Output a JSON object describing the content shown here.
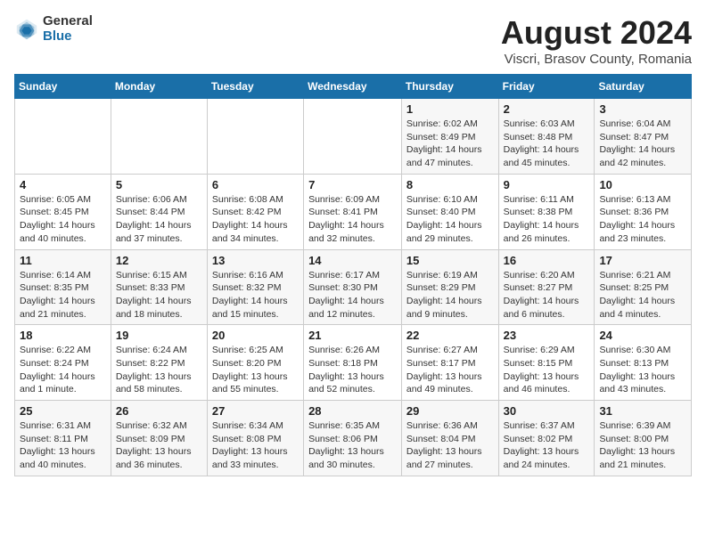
{
  "logo": {
    "general": "General",
    "blue": "Blue"
  },
  "title": "August 2024",
  "subtitle": "Viscri, Brasov County, Romania",
  "days_of_week": [
    "Sunday",
    "Monday",
    "Tuesday",
    "Wednesday",
    "Thursday",
    "Friday",
    "Saturday"
  ],
  "weeks": [
    [
      {
        "day": "",
        "info": ""
      },
      {
        "day": "",
        "info": ""
      },
      {
        "day": "",
        "info": ""
      },
      {
        "day": "",
        "info": ""
      },
      {
        "day": "1",
        "info": "Sunrise: 6:02 AM\nSunset: 8:49 PM\nDaylight: 14 hours and 47 minutes."
      },
      {
        "day": "2",
        "info": "Sunrise: 6:03 AM\nSunset: 8:48 PM\nDaylight: 14 hours and 45 minutes."
      },
      {
        "day": "3",
        "info": "Sunrise: 6:04 AM\nSunset: 8:47 PM\nDaylight: 14 hours and 42 minutes."
      }
    ],
    [
      {
        "day": "4",
        "info": "Sunrise: 6:05 AM\nSunset: 8:45 PM\nDaylight: 14 hours and 40 minutes."
      },
      {
        "day": "5",
        "info": "Sunrise: 6:06 AM\nSunset: 8:44 PM\nDaylight: 14 hours and 37 minutes."
      },
      {
        "day": "6",
        "info": "Sunrise: 6:08 AM\nSunset: 8:42 PM\nDaylight: 14 hours and 34 minutes."
      },
      {
        "day": "7",
        "info": "Sunrise: 6:09 AM\nSunset: 8:41 PM\nDaylight: 14 hours and 32 minutes."
      },
      {
        "day": "8",
        "info": "Sunrise: 6:10 AM\nSunset: 8:40 PM\nDaylight: 14 hours and 29 minutes."
      },
      {
        "day": "9",
        "info": "Sunrise: 6:11 AM\nSunset: 8:38 PM\nDaylight: 14 hours and 26 minutes."
      },
      {
        "day": "10",
        "info": "Sunrise: 6:13 AM\nSunset: 8:36 PM\nDaylight: 14 hours and 23 minutes."
      }
    ],
    [
      {
        "day": "11",
        "info": "Sunrise: 6:14 AM\nSunset: 8:35 PM\nDaylight: 14 hours and 21 minutes."
      },
      {
        "day": "12",
        "info": "Sunrise: 6:15 AM\nSunset: 8:33 PM\nDaylight: 14 hours and 18 minutes."
      },
      {
        "day": "13",
        "info": "Sunrise: 6:16 AM\nSunset: 8:32 PM\nDaylight: 14 hours and 15 minutes."
      },
      {
        "day": "14",
        "info": "Sunrise: 6:17 AM\nSunset: 8:30 PM\nDaylight: 14 hours and 12 minutes."
      },
      {
        "day": "15",
        "info": "Sunrise: 6:19 AM\nSunset: 8:29 PM\nDaylight: 14 hours and 9 minutes."
      },
      {
        "day": "16",
        "info": "Sunrise: 6:20 AM\nSunset: 8:27 PM\nDaylight: 14 hours and 6 minutes."
      },
      {
        "day": "17",
        "info": "Sunrise: 6:21 AM\nSunset: 8:25 PM\nDaylight: 14 hours and 4 minutes."
      }
    ],
    [
      {
        "day": "18",
        "info": "Sunrise: 6:22 AM\nSunset: 8:24 PM\nDaylight: 14 hours and 1 minute."
      },
      {
        "day": "19",
        "info": "Sunrise: 6:24 AM\nSunset: 8:22 PM\nDaylight: 13 hours and 58 minutes."
      },
      {
        "day": "20",
        "info": "Sunrise: 6:25 AM\nSunset: 8:20 PM\nDaylight: 13 hours and 55 minutes."
      },
      {
        "day": "21",
        "info": "Sunrise: 6:26 AM\nSunset: 8:18 PM\nDaylight: 13 hours and 52 minutes."
      },
      {
        "day": "22",
        "info": "Sunrise: 6:27 AM\nSunset: 8:17 PM\nDaylight: 13 hours and 49 minutes."
      },
      {
        "day": "23",
        "info": "Sunrise: 6:29 AM\nSunset: 8:15 PM\nDaylight: 13 hours and 46 minutes."
      },
      {
        "day": "24",
        "info": "Sunrise: 6:30 AM\nSunset: 8:13 PM\nDaylight: 13 hours and 43 minutes."
      }
    ],
    [
      {
        "day": "25",
        "info": "Sunrise: 6:31 AM\nSunset: 8:11 PM\nDaylight: 13 hours and 40 minutes."
      },
      {
        "day": "26",
        "info": "Sunrise: 6:32 AM\nSunset: 8:09 PM\nDaylight: 13 hours and 36 minutes."
      },
      {
        "day": "27",
        "info": "Sunrise: 6:34 AM\nSunset: 8:08 PM\nDaylight: 13 hours and 33 minutes."
      },
      {
        "day": "28",
        "info": "Sunrise: 6:35 AM\nSunset: 8:06 PM\nDaylight: 13 hours and 30 minutes."
      },
      {
        "day": "29",
        "info": "Sunrise: 6:36 AM\nSunset: 8:04 PM\nDaylight: 13 hours and 27 minutes."
      },
      {
        "day": "30",
        "info": "Sunrise: 6:37 AM\nSunset: 8:02 PM\nDaylight: 13 hours and 24 minutes."
      },
      {
        "day": "31",
        "info": "Sunrise: 6:39 AM\nSunset: 8:00 PM\nDaylight: 13 hours and 21 minutes."
      }
    ]
  ]
}
